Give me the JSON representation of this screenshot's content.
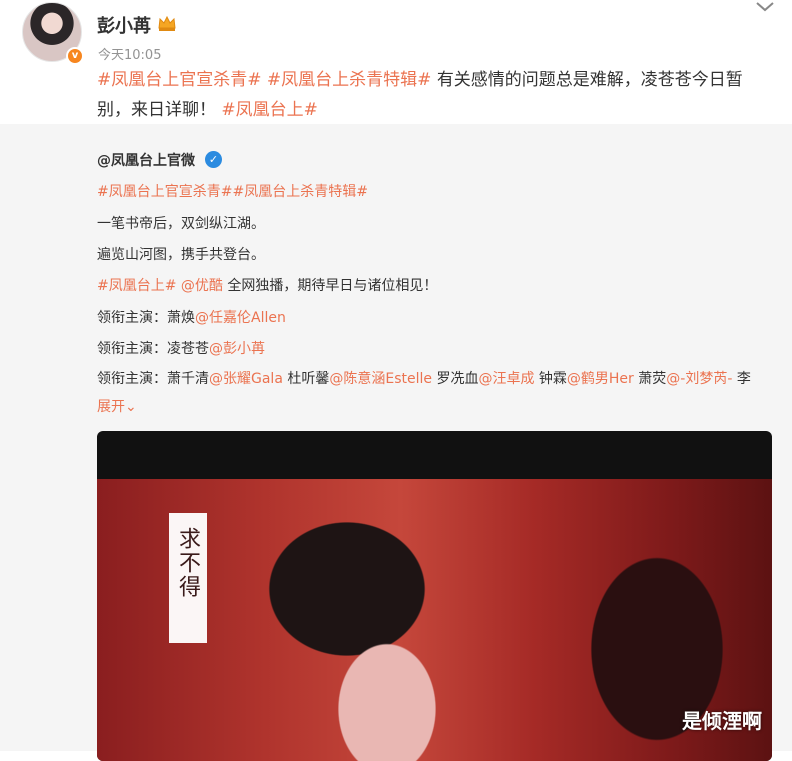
{
  "post": {
    "username": "彭小苒",
    "timestamp": "今天10:05",
    "text": {
      "topic1": "#凤凰台上官宣杀青#",
      "topic2": "#凤凰台上杀青特辑#",
      "body": " 有关感情的问题总是难解，凌苍苍今日暂别，来日详聊！",
      "topic3": "#凤凰台上#"
    }
  },
  "retweet": {
    "author": "@凤凰台上官微",
    "topics_line": "#凤凰台上官宣杀青##凤凰台上杀青特辑#",
    "line1": "一笔书帝后，双剑纵江湖。",
    "line2": "遍览山河图，携手共登台。",
    "line3": {
      "topic": "#凤凰台上#",
      "mention": " @优酷",
      "text": " 全网独播，期待早日与诸位相见！"
    },
    "line4": {
      "prefix": "领衔主演：萧焕",
      "mention": "@任嘉伦Allen"
    },
    "line5": {
      "prefix": "领衔主演：凌苍苍",
      "mention": "@彭小苒"
    },
    "line6": {
      "prefix": "领衔主演：萧千清",
      "m1": "@张耀Gala",
      "t1": " 杜听馨",
      "m2": "@陈意涵Estelle",
      "t2": " 罗冼血",
      "m3": "@汪卓成",
      "t3": " 钟霖",
      "m4": "@鹤男Her",
      "t4": " 萧荧",
      "m5": "@-刘梦芮-",
      "t5": " 李",
      "expand": "展开"
    }
  },
  "video": {
    "caption": "求不得"
  },
  "watermark": "是倾湮啊",
  "colors": {
    "accent": "#eb7350",
    "verified": "#2b8be0",
    "badge": "#f7861f",
    "timestamp": "#939393"
  },
  "icons": [
    "crown-icon",
    "chevron-down-icon",
    "verified-icon",
    "avatar-badge-icon"
  ]
}
